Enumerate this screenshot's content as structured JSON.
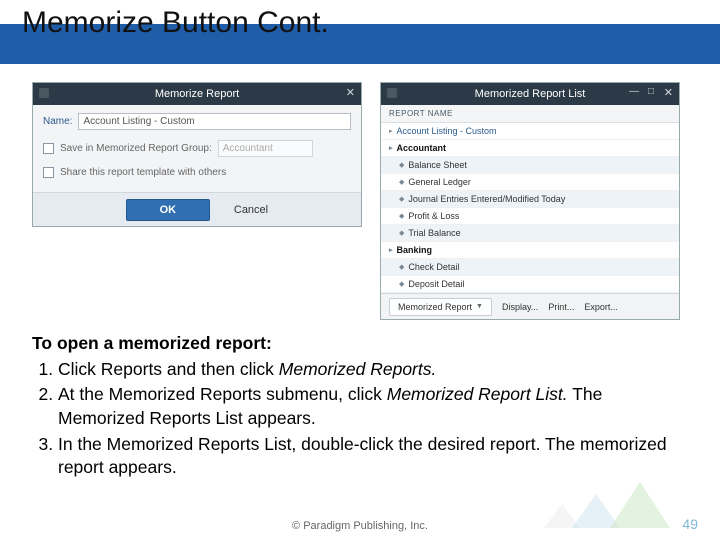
{
  "title": "Memorize Button Cont.",
  "dialog1": {
    "title": "Memorize Report",
    "close": "✕",
    "nameLabel": "Name:",
    "nameValue": "Account Listing - Custom",
    "saveGroupLabel": "Save in Memorized Report Group:",
    "groupValue": "Accountant",
    "shareLabel": "Share this report template with others",
    "ok": "OK",
    "cancel": "Cancel"
  },
  "dialog2": {
    "title": "Memorized Report List",
    "close": "✕",
    "minmax": "—  □",
    "colHeader": "REPORT NAME",
    "rows": [
      {
        "label": "Account Listing - Custom",
        "cls": "top",
        "arrow": "▸"
      },
      {
        "label": "Accountant",
        "cls": "bold",
        "arrow": "▸"
      },
      {
        "label": "Balance Sheet",
        "cls": "sub alt",
        "arrow": "◆"
      },
      {
        "label": "General Ledger",
        "cls": "sub",
        "arrow": "◆"
      },
      {
        "label": "Journal Entries Entered/Modified Today",
        "cls": "sub alt",
        "arrow": "◆"
      },
      {
        "label": "Profit & Loss",
        "cls": "sub",
        "arrow": "◆"
      },
      {
        "label": "Trial Balance",
        "cls": "sub alt",
        "arrow": "◆"
      },
      {
        "label": "Banking",
        "cls": "bold",
        "arrow": "▸"
      },
      {
        "label": "Check Detail",
        "cls": "sub alt",
        "arrow": "◆"
      },
      {
        "label": "Deposit Detail",
        "cls": "sub",
        "arrow": "◆"
      }
    ],
    "toolbar": {
      "memorized": "Memorized Report",
      "display": "Display...",
      "print": "Print...",
      "export": "Export..."
    }
  },
  "instr": {
    "lead": "To open a memorized report:",
    "s1a": "Click Reports and then click ",
    "s1b": "Memorized Reports.",
    "s2a": "At the Memorized Reports submenu, click ",
    "s2b": "Memorized Report List.",
    "s2c": " The Memorized Reports List appears.",
    "s3": "In the Memorized Reports List, double-click the desired report. The memorized report appears."
  },
  "footer": "© Paradigm Publishing, Inc.",
  "page": "49"
}
